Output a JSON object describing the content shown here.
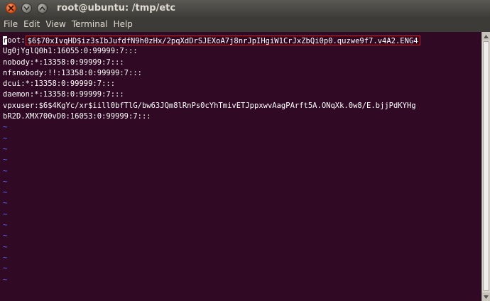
{
  "window": {
    "title": "root@ubuntu: /tmp/etc"
  },
  "menu": [
    {
      "label": "File"
    },
    {
      "label": "Edit"
    },
    {
      "label": "View"
    },
    {
      "label": "Terminal"
    },
    {
      "label": "Help"
    }
  ],
  "terminal": {
    "line1_cursor": "r",
    "line1_user": "oot:",
    "line1_hash": "$6$70xIvqHD$iz3sIbJufdfN9h0zHx/2pqXdDrSJEXoA7j8nrJpIHgiW1CrJxZbQi0p0.quzwe9f7.v4A2.ENG4",
    "lines": [
      "Ug0jYglQ0h1:16055:0:99999:7:::",
      "nobody:*:13358:0:99999:7:::",
      "nfsnobody:!!:13358:0:99999:7:::",
      "dcui:*:13358:0:99999:7:::",
      "daemon:*:13358:0:99999:7:::",
      "vpxuser:$6$4KgYc/xr$iill0bfTlG/bw63JQm8lRnPs0cYhTmivETJppxwvAagPArft5A.ONqXk.0w8/E.bjjPdKYHg",
      "bR2D.XMX700vD0:16053:0:99999:7:::"
    ],
    "tildes": [
      "~",
      "~",
      "~",
      "~",
      "~",
      "~",
      "~",
      "~",
      "~",
      "~",
      "~",
      "~",
      "~",
      "~",
      "~"
    ]
  },
  "colors": {
    "terminal_bg": "#300a24",
    "highlight": "#d71a1a",
    "tilde": "#6767ff"
  }
}
